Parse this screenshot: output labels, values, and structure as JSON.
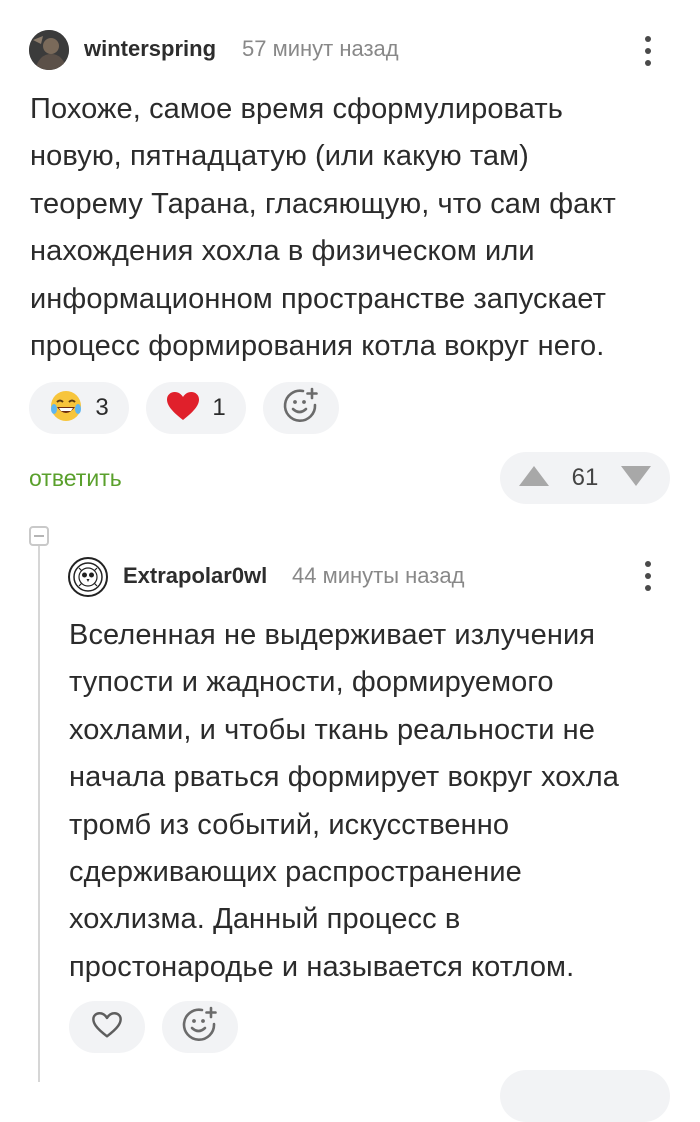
{
  "comment": {
    "username": "winterspring",
    "time": "57 минут назад",
    "text": "Похоже, самое время сформулировать\nновую, пятнадцатую (или какую там)\nтеорему Тарана, гласяющую, что сам факт\nнахождения хохла в физическом или\nинформационном пространстве запускает\nпроцесс формирования котла вокруг него.",
    "reactions": [
      {
        "icon": "laughing-emoji-icon",
        "count": "3"
      },
      {
        "icon": "heart-icon",
        "count": "1"
      },
      {
        "icon": "add-reaction-icon",
        "count": ""
      }
    ],
    "reply_label": "ответить",
    "rating": "61"
  },
  "reply": {
    "username": "Extrapolar0wl",
    "time": "44 минуты назад",
    "text": "Вселенная не выдерживает излучения\nтупости и жадности, формируемого\nхохлами, и чтобы ткань реальности не\nначала рваться формирует вокруг хохла\nтромб из событий, искусственно\nсдерживающих распространение\nхохлизма. Данный процесс в\nпростонародье и называется котлом.",
    "reactions": [
      {
        "icon": "heart-outline-icon",
        "count": ""
      },
      {
        "icon": "add-reaction-icon",
        "count": ""
      }
    ]
  },
  "colors": {
    "accent_green": "#5aa02c",
    "heart_red": "#e0202b",
    "chip_bg": "#f2f3f5"
  }
}
